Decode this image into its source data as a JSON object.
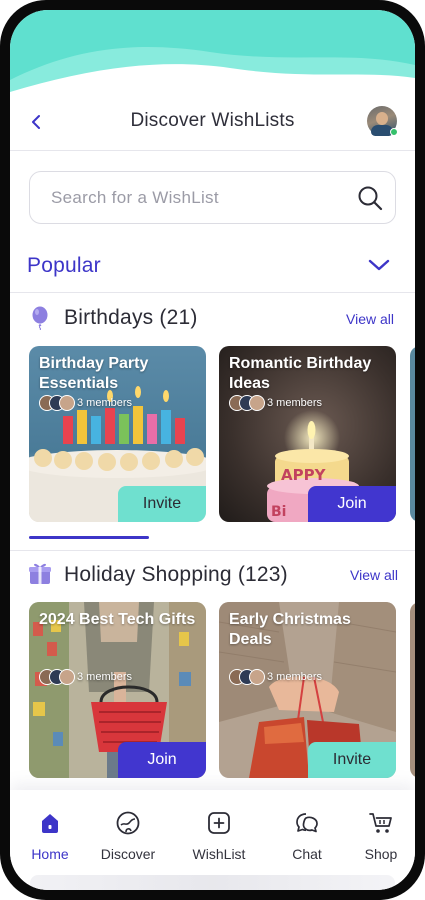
{
  "header": {
    "title": "Discover WishLists"
  },
  "search": {
    "placeholder": "Search for a WishList"
  },
  "popular": {
    "label": "Popular"
  },
  "categories": [
    {
      "title": "Birthdays (21)",
      "view_all": "View all",
      "cards": [
        {
          "title": "Birthday Party Essentials",
          "members": "3 members",
          "action": "Invite"
        },
        {
          "title": "Romantic Birthday Ideas",
          "members": "3 members",
          "action": "Join"
        }
      ]
    },
    {
      "title": "Holiday Shopping (123)",
      "view_all": "View all",
      "cards": [
        {
          "title": "2024 Best Tech Gifts",
          "members": "3 members",
          "action": "Join"
        },
        {
          "title": "Early Christmas Deals",
          "members": "3 members",
          "action": "Invite"
        }
      ]
    }
  ],
  "tabbar": {
    "items": [
      {
        "label": "Home",
        "icon": "home-icon",
        "active": true
      },
      {
        "label": "Discover",
        "icon": "discover-icon",
        "active": false
      },
      {
        "label": "WishList",
        "icon": "add-square-icon",
        "active": false
      },
      {
        "label": "Chat",
        "icon": "chat-icon",
        "active": false
      },
      {
        "label": "Shop",
        "icon": "cart-icon",
        "active": false
      }
    ]
  },
  "colors": {
    "accent": "#3d35c8",
    "teal": "#6fe0cf",
    "join_button": "#4136cf"
  }
}
